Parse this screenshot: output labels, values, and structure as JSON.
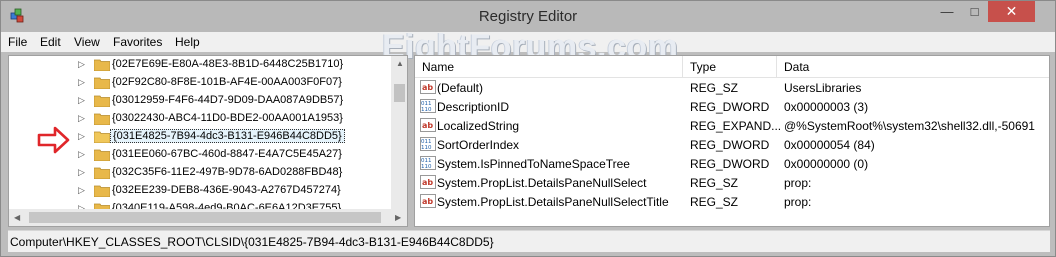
{
  "window": {
    "title": "Registry Editor",
    "controls": {
      "minimize": "—",
      "maximize": "□",
      "close": "✕"
    }
  },
  "watermark": "EightForums.com",
  "menu": [
    "File",
    "Edit",
    "View",
    "Favorites",
    "Help"
  ],
  "tree": {
    "items": [
      {
        "label": "{02E7E69E-E80A-48E3-8B1D-6448C25B1710}",
        "selected": false
      },
      {
        "label": "{02F92C80-8F8E-101B-AF4E-00AA003F0F07}",
        "selected": false
      },
      {
        "label": "{03012959-F4F6-44D7-9D09-DAA087A9DB57}",
        "selected": false
      },
      {
        "label": "{03022430-ABC4-11D0-BDE2-00AA001A1953}",
        "selected": false
      },
      {
        "label": "{031E4825-7B94-4dc3-B131-E946B44C8DD5}",
        "selected": true
      },
      {
        "label": "{031EE060-67BC-460d-8847-E4A7C5E45A27}",
        "selected": false
      },
      {
        "label": "{032C35F6-11E2-497B-9D78-6AD0288FBD48}",
        "selected": false
      },
      {
        "label": "{032EE239-DEB8-436E-9043-A2767D457274}",
        "selected": false
      },
      {
        "label": "{0340E119-A598-4ed9-B0AC-6E6A12D3E755}",
        "selected": false
      }
    ]
  },
  "list": {
    "columns": {
      "name": "Name",
      "type": "Type",
      "data": "Data"
    },
    "rows": [
      {
        "name": "(Default)",
        "type": "REG_SZ",
        "data": "UsersLibraries",
        "icon": "string-value-icon"
      },
      {
        "name": "DescriptionID",
        "type": "REG_DWORD",
        "data": "0x00000003 (3)",
        "icon": "binary-value-icon"
      },
      {
        "name": "LocalizedString",
        "type": "REG_EXPAND...",
        "data": "@%SystemRoot%\\system32\\shell32.dll,-50691",
        "icon": "string-value-icon"
      },
      {
        "name": "SortOrderIndex",
        "type": "REG_DWORD",
        "data": "0x00000054 (84)",
        "icon": "binary-value-icon"
      },
      {
        "name": "System.IsPinnedToNameSpaceTree",
        "type": "REG_DWORD",
        "data": "0x00000000 (0)",
        "icon": "binary-value-icon"
      },
      {
        "name": "System.PropList.DetailsPaneNullSelect",
        "type": "REG_SZ",
        "data": "prop:",
        "icon": "string-value-icon"
      },
      {
        "name": "System.PropList.DetailsPaneNullSelectTitle",
        "type": "REG_SZ",
        "data": "prop:",
        "icon": "string-value-icon"
      }
    ]
  },
  "status": "Computer\\HKEY_CLASSES_ROOT\\CLSID\\{031E4825-7B94-4dc3-B131-E946B44C8DD5}",
  "colors": {
    "accent_red": "#e0262a",
    "folder": "#e8b84a",
    "close": "#c7504b"
  }
}
